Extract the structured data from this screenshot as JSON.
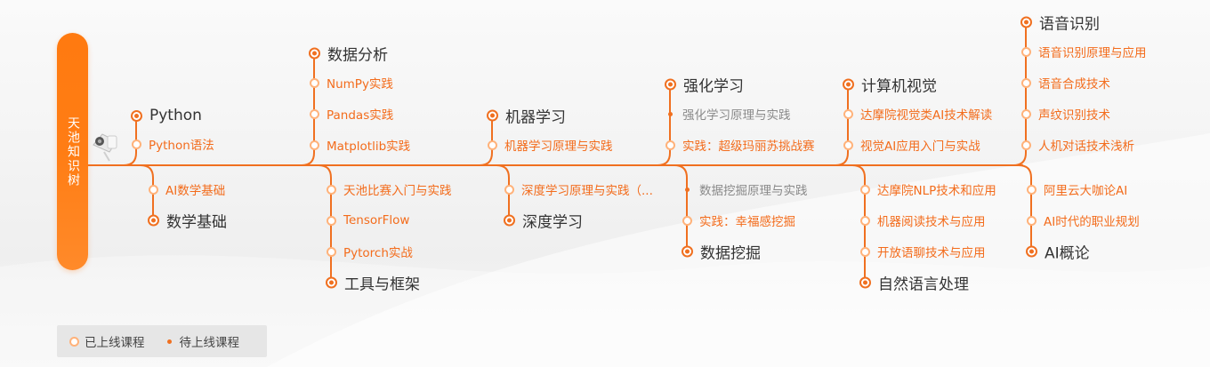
{
  "title": "天池知识树",
  "legend": {
    "online": "已上线课程",
    "pending": "待上线课程"
  },
  "colors": {
    "accent": "#f07020",
    "online_ring": "#ffb27a",
    "pending_text": "#8a8a8a",
    "course_text": "#f36c1c"
  },
  "icons": [
    "camera-icon"
  ],
  "branches": {
    "python": {
      "name": "Python",
      "courses": [
        {
          "label": "Python语法",
          "status": "online"
        }
      ]
    },
    "math": {
      "name": "数学基础",
      "courses": [
        {
          "label": "AI数学基础",
          "status": "online"
        }
      ]
    },
    "data_analysis": {
      "name": "数据分析",
      "courses": [
        {
          "label": "NumPy实践",
          "status": "online"
        },
        {
          "label": "Pandas实践",
          "status": "online"
        },
        {
          "label": "Matplotlib实践",
          "status": "online"
        }
      ]
    },
    "tools": {
      "name": "工具与框架",
      "courses": [
        {
          "label": "天池比赛入门与实践",
          "status": "online"
        },
        {
          "label": "TensorFlow",
          "status": "online"
        },
        {
          "label": "Pytorch实战",
          "status": "online"
        }
      ]
    },
    "ml": {
      "name": "机器学习",
      "courses": [
        {
          "label": "机器学习原理与实践",
          "status": "online"
        }
      ]
    },
    "dl": {
      "name": "深度学习",
      "courses": [
        {
          "label": "深度学习原理与实践（...",
          "status": "online"
        }
      ]
    },
    "rl": {
      "name": "强化学习",
      "courses": [
        {
          "label": "强化学习原理与实践",
          "status": "pending"
        },
        {
          "label": "实践：超级玛丽苏挑战赛",
          "status": "online"
        }
      ]
    },
    "dm": {
      "name": "数据挖掘",
      "courses": [
        {
          "label": "数据挖掘原理与实践",
          "status": "pending"
        },
        {
          "label": "实践：幸福感挖掘",
          "status": "online"
        }
      ]
    },
    "cv": {
      "name": "计算机视觉",
      "courses": [
        {
          "label": "达摩院视觉类AI技术解读",
          "status": "online"
        },
        {
          "label": "视觉AI应用入门与实战",
          "status": "online"
        }
      ]
    },
    "nlp": {
      "name": "自然语言处理",
      "courses": [
        {
          "label": "达摩院NLP技术和应用",
          "status": "online"
        },
        {
          "label": "机器阅读技术与应用",
          "status": "online"
        },
        {
          "label": "开放语聊技术与应用",
          "status": "online"
        }
      ]
    },
    "speech": {
      "name": "语音识别",
      "courses": [
        {
          "label": "语音识别原理与应用",
          "status": "online"
        },
        {
          "label": "语音合成技术",
          "status": "online"
        },
        {
          "label": "声纹识别技术",
          "status": "online"
        },
        {
          "label": "人机对话技术浅析",
          "status": "online"
        }
      ]
    },
    "ai": {
      "name": "AI概论",
      "courses": [
        {
          "label": "阿里云大咖论AI",
          "status": "online"
        },
        {
          "label": "AI时代的职业规划",
          "status": "online"
        }
      ]
    }
  }
}
